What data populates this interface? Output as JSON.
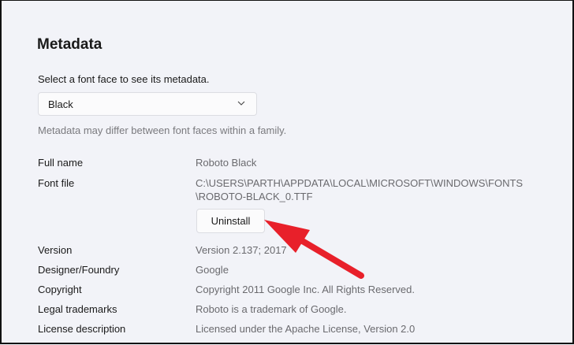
{
  "section_title": "Metadata",
  "prompt": "Select a font face to see its metadata.",
  "font_face_select": {
    "value": "Black"
  },
  "hint": "Metadata may differ between font faces within a family.",
  "fields": {
    "full_name": {
      "label": "Full name",
      "value": "Roboto Black"
    },
    "font_file": {
      "label": "Font file",
      "value_line1": "C:\\USERS\\PARTH\\APPDATA\\LOCAL\\MICROSOFT\\WINDOWS\\FONTS",
      "value_line2": "\\ROBOTO-BLACK_0.TTF"
    },
    "version": {
      "label": "Version",
      "value": "Version 2.137; 2017"
    },
    "designer": {
      "label": "Designer/Foundry",
      "value": "Google"
    },
    "copyright": {
      "label": "Copyright",
      "value": "Copyright 2011 Google Inc. All Rights Reserved."
    },
    "trademarks": {
      "label": "Legal trademarks",
      "value": "Roboto is a trademark of Google."
    },
    "license": {
      "label": "License description",
      "value": "Licensed under the Apache License, Version 2.0"
    }
  },
  "uninstall_label": "Uninstall",
  "annotation_color": "#e8202a"
}
